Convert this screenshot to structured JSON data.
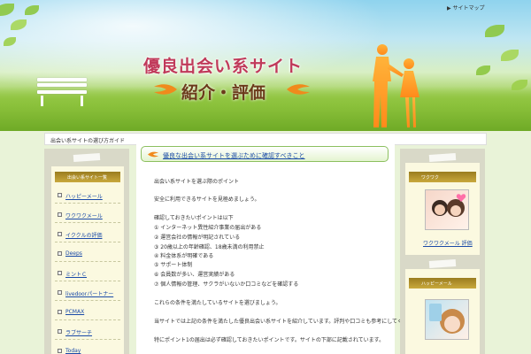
{
  "header": {
    "title": "優良出会い系サイト",
    "subtitle": "紹介・評価",
    "sitemap_link": "サイトマップ"
  },
  "breadcrumb": "出会い系サイトの選び方ガイド",
  "sidebar_left": {
    "heading": "出会い系サイト一覧",
    "items": [
      {
        "label": "ハッピーメール"
      },
      {
        "label": "ワクワクメール"
      },
      {
        "label": "イククルの評価"
      },
      {
        "label": "Deeps"
      },
      {
        "label": "ミントＣ"
      },
      {
        "label": "livedoorパートナー"
      },
      {
        "label": "PCMAX"
      },
      {
        "label": "ラブサーチ"
      },
      {
        "label": "Today"
      }
    ]
  },
  "main": {
    "title": "優良な出会い系サイトを選ぶために確認すべきこと",
    "lines": [
      "出会い系サイトを選ぶ際のポイント",
      "安全に利用できるサイトを見極めましょう。",
      "確認しておきたいポイントは以下",
      "① インターネット異性紹介事業の届出がある",
      "② 運営会社の情報が明記されている",
      "③ 20歳以上の年齢確認、18歳未満の利用禁止",
      "④ 料金体系が明確である",
      "⑤ サポート体制",
      "⑥ 会員数が多い、運営実績がある",
      "⑦ 個人情報の管理、サクラがいないか口コミなどを確認する",
      "これらの条件を満たしているサイトを選びましょう。",
      "当サイトでは上記の条件を満たした優良出会い系サイトを紹介しています。評判や口コミも参考にしてください。",
      "特にポイント1の届出は必ず確認しておきたいポイントです。サイトの下部に記載されています。"
    ]
  },
  "sidebar_right": {
    "box1": {
      "heading": "ワクワク",
      "link": "ワクワクメール 評価"
    },
    "box2": {
      "heading": "ハッピーメール"
    }
  },
  "colors": {
    "link": "#1a4aa8",
    "box_head": "#9a7c1f",
    "title_pink": "#c03a5a"
  }
}
